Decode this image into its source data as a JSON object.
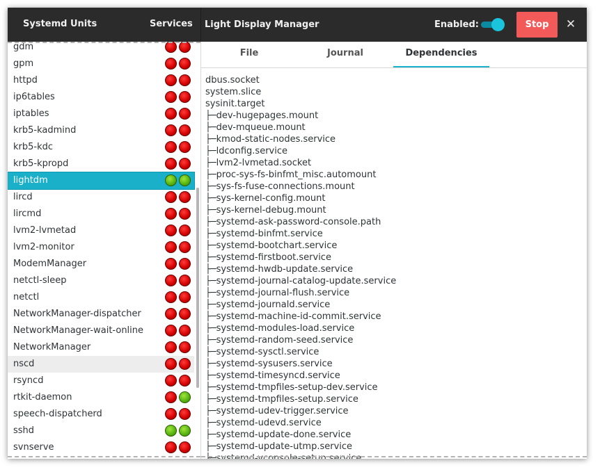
{
  "header": {
    "sidebar_title": "Systemd Units",
    "services_label": "Services",
    "unit_title": "Light Display Manager",
    "enabled_label": "Enabled:",
    "enabled": true,
    "stop_label": "Stop",
    "close_label": "✕"
  },
  "colors": {
    "accent": "#19b3d0",
    "stop": "#f25a5a",
    "header_bg": "#2b2b2b",
    "status_red": "#d20000",
    "status_green": "#55b10e"
  },
  "units": [
    {
      "name": "gdm",
      "s1": "red",
      "s2": "red"
    },
    {
      "name": "gpm",
      "s1": "red",
      "s2": "red"
    },
    {
      "name": "httpd",
      "s1": "red",
      "s2": "red"
    },
    {
      "name": "ip6tables",
      "s1": "red",
      "s2": "red"
    },
    {
      "name": "iptables",
      "s1": "red",
      "s2": "red"
    },
    {
      "name": "krb5-kadmind",
      "s1": "red",
      "s2": "red"
    },
    {
      "name": "krb5-kdc",
      "s1": "red",
      "s2": "red"
    },
    {
      "name": "krb5-kpropd",
      "s1": "red",
      "s2": "red"
    },
    {
      "name": "lightdm",
      "s1": "green",
      "s2": "green",
      "selected": true
    },
    {
      "name": "lircd",
      "s1": "red",
      "s2": "red"
    },
    {
      "name": "lircmd",
      "s1": "red",
      "s2": "red"
    },
    {
      "name": "lvm2-lvmetad",
      "s1": "red",
      "s2": "red"
    },
    {
      "name": "lvm2-monitor",
      "s1": "red",
      "s2": "red"
    },
    {
      "name": "ModemManager",
      "s1": "red",
      "s2": "red"
    },
    {
      "name": "netctl-sleep",
      "s1": "red",
      "s2": "red"
    },
    {
      "name": "netctl",
      "s1": "red",
      "s2": "red"
    },
    {
      "name": "NetworkManager-dispatcher",
      "s1": "red",
      "s2": "red"
    },
    {
      "name": "NetworkManager-wait-online",
      "s1": "red",
      "s2": "red"
    },
    {
      "name": "NetworkManager",
      "s1": "red",
      "s2": "red"
    },
    {
      "name": "nscd",
      "s1": "red",
      "s2": "red",
      "hover": true
    },
    {
      "name": "rsyncd",
      "s1": "red",
      "s2": "red"
    },
    {
      "name": "rtkit-daemon",
      "s1": "red",
      "s2": "green"
    },
    {
      "name": "speech-dispatcherd",
      "s1": "red",
      "s2": "red"
    },
    {
      "name": "sshd",
      "s1": "green",
      "s2": "green"
    },
    {
      "name": "svnserve",
      "s1": "red",
      "s2": "red"
    }
  ],
  "tabs": [
    {
      "label": "File",
      "active": false
    },
    {
      "label": "Journal",
      "active": false
    },
    {
      "label": "Dependencies",
      "active": true
    }
  ],
  "dependencies": {
    "top": [
      "dbus.socket",
      "system.slice",
      "sysinit.target"
    ],
    "children": [
      "dev-hugepages.mount",
      "dev-mqueue.mount",
      "kmod-static-nodes.service",
      "ldconfig.service",
      "lvm2-lvmetad.socket",
      "proc-sys-fs-binfmt_misc.automount",
      "sys-fs-fuse-connections.mount",
      "sys-kernel-config.mount",
      "sys-kernel-debug.mount",
      "systemd-ask-password-console.path",
      "systemd-binfmt.service",
      "systemd-bootchart.service",
      "systemd-firstboot.service",
      "systemd-hwdb-update.service",
      "systemd-journal-catalog-update.service",
      "systemd-journal-flush.service",
      "systemd-journald.service",
      "systemd-machine-id-commit.service",
      "systemd-modules-load.service",
      "systemd-random-seed.service",
      "systemd-sysctl.service",
      "systemd-sysusers.service",
      "systemd-timesyncd.service",
      "systemd-tmpfiles-setup-dev.service",
      "systemd-tmpfiles-setup.service",
      "systemd-udev-trigger.service",
      "systemd-udevd.service",
      "systemd-update-done.service",
      "systemd-update-utmp.service",
      "systemd-vconsole-setup.service"
    ],
    "branch": "├─"
  }
}
